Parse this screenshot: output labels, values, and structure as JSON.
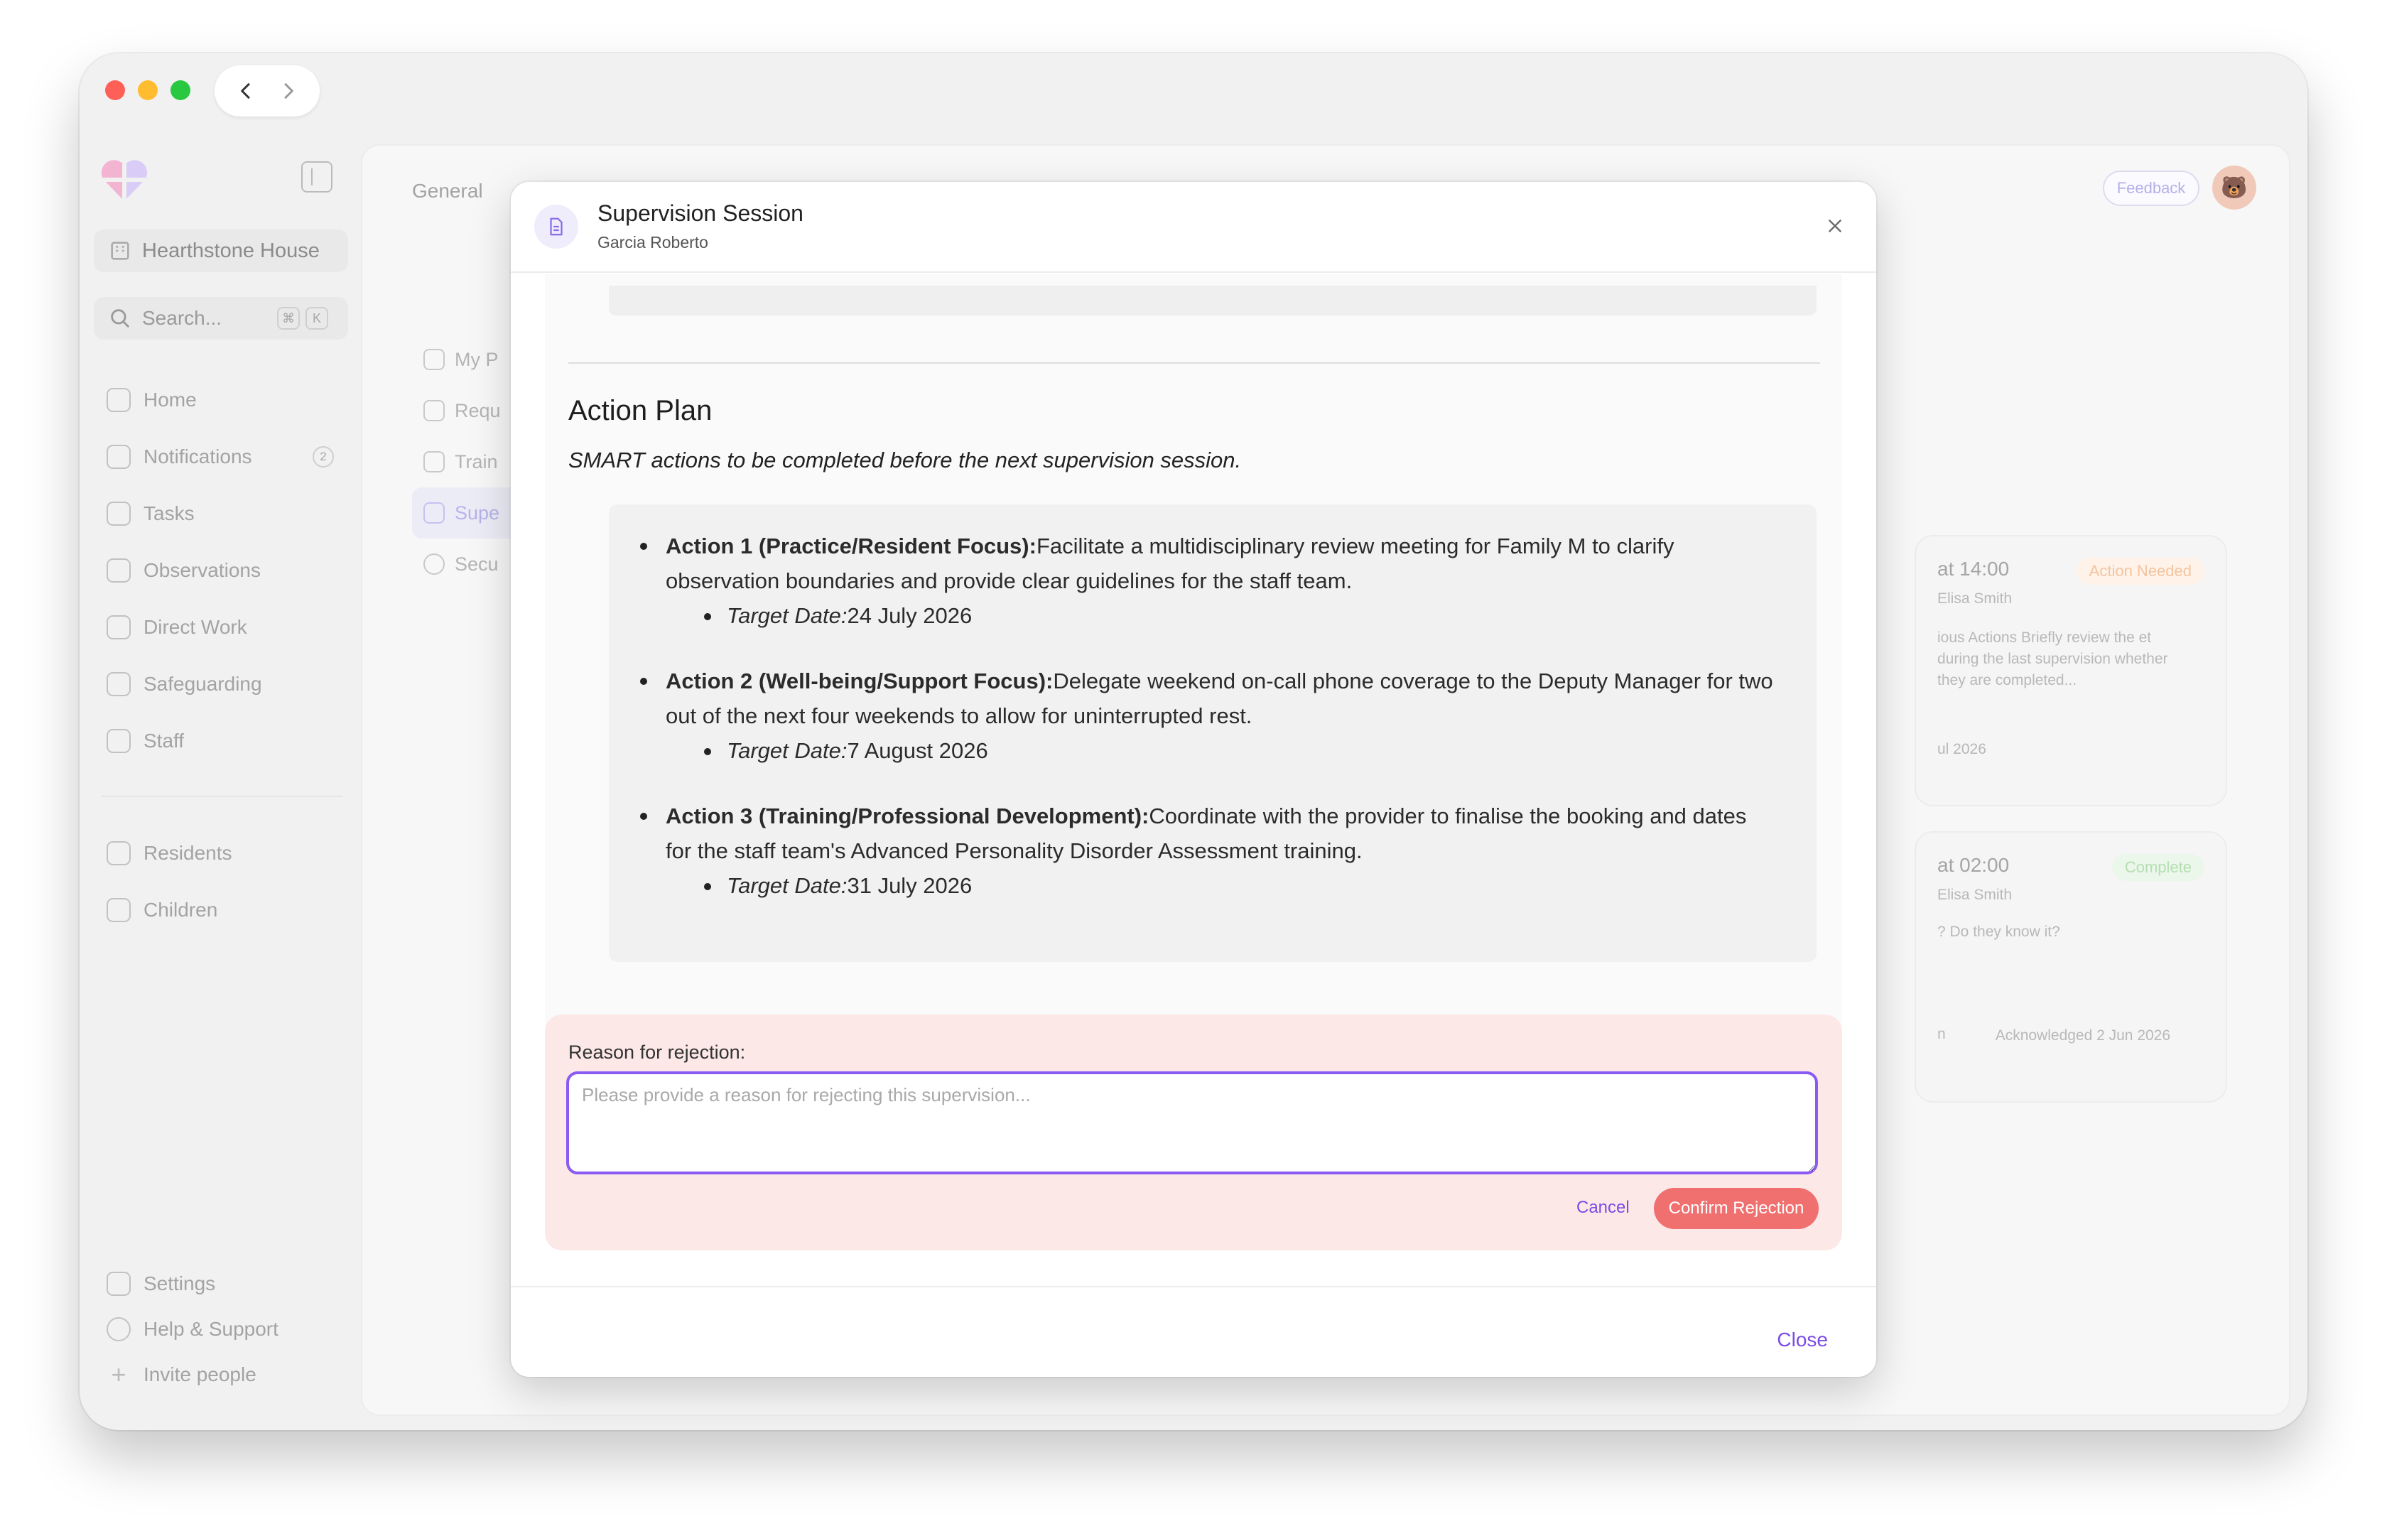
{
  "sidebar": {
    "house_name": "Hearthstone House",
    "search_placeholder": "Search...",
    "search_kbd": [
      "⌘",
      "K"
    ],
    "nav": [
      {
        "label": "Home",
        "icon": "home-icon"
      },
      {
        "label": "Notifications",
        "icon": "inbox-icon",
        "badge": "2"
      },
      {
        "label": "Tasks",
        "icon": "pencil-icon"
      },
      {
        "label": "Observations",
        "icon": "eye-icon"
      },
      {
        "label": "Direct Work",
        "icon": "graduation-cap-icon"
      },
      {
        "label": "Safeguarding",
        "icon": "shield-icon"
      },
      {
        "label": "Staff",
        "icon": "users-icon"
      }
    ],
    "groups": [
      {
        "label": "Residents",
        "icon": "users-icon"
      },
      {
        "label": "Children",
        "icon": "stroller-icon"
      }
    ],
    "bottom": [
      {
        "label": "Settings",
        "icon": "gear-icon"
      },
      {
        "label": "Help & Support",
        "icon": "help-circle-icon"
      },
      {
        "label": "Invite people",
        "icon": "plus-icon"
      }
    ]
  },
  "main": {
    "tab": "General",
    "feedback": "Feedback",
    "subnav": [
      "My P",
      "Requ",
      "Train",
      "Supe",
      "Secu"
    ],
    "cards": [
      {
        "title": "at 14:00",
        "person": "Elisa Smith",
        "status": "Action Needed",
        "text": "ious Actions Briefly review the et during the last supervision whether they are completed...",
        "date": "ul 2026"
      },
      {
        "title": "at 02:00",
        "person": "Elisa Smith",
        "status": "Complete",
        "text": "? Do they know it?",
        "ack": "Acknowledged 2 Jun 2026",
        "extra": "n"
      }
    ]
  },
  "modal": {
    "title": "Supervision Session",
    "subtitle": "Garcia Roberto",
    "section_title": "Action Plan",
    "section_subtitle": "SMART actions to be completed before the next supervision session.",
    "actions": [
      {
        "label": "Action 1 (Practice/Resident Focus):",
        "text": "Facilitate a multidisciplinary review meeting for Family M to clarify observation boundaries and provide clear guidelines for the staff team.",
        "target_label": "Target Date:",
        "target_date": "24 July 2026"
      },
      {
        "label": "Action 2 (Well-being/Support Focus):",
        "text": "Delegate weekend on-call phone coverage to the Deputy Manager for two out of the next four weekends to allow for uninterrupted rest.",
        "target_label": "Target Date:",
        "target_date": "7 August 2026"
      },
      {
        "label": "Action 3 (Training/Professional Development):",
        "text": "Coordinate with the provider to finalise the booking and dates for the staff team's Advanced Personality Disorder Assessment training.",
        "target_label": "Target Date:",
        "target_date": "31 July 2026"
      }
    ],
    "rejection": {
      "label": "Reason for rejection:",
      "placeholder": "Please provide a reason for rejecting this supervision...",
      "value": "",
      "cancel": "Cancel",
      "confirm": "Confirm Rejection"
    },
    "close": "Close"
  },
  "colors": {
    "accent": "#7b4be6",
    "danger": "#f07070",
    "reject_bg": "#fde8e8"
  }
}
